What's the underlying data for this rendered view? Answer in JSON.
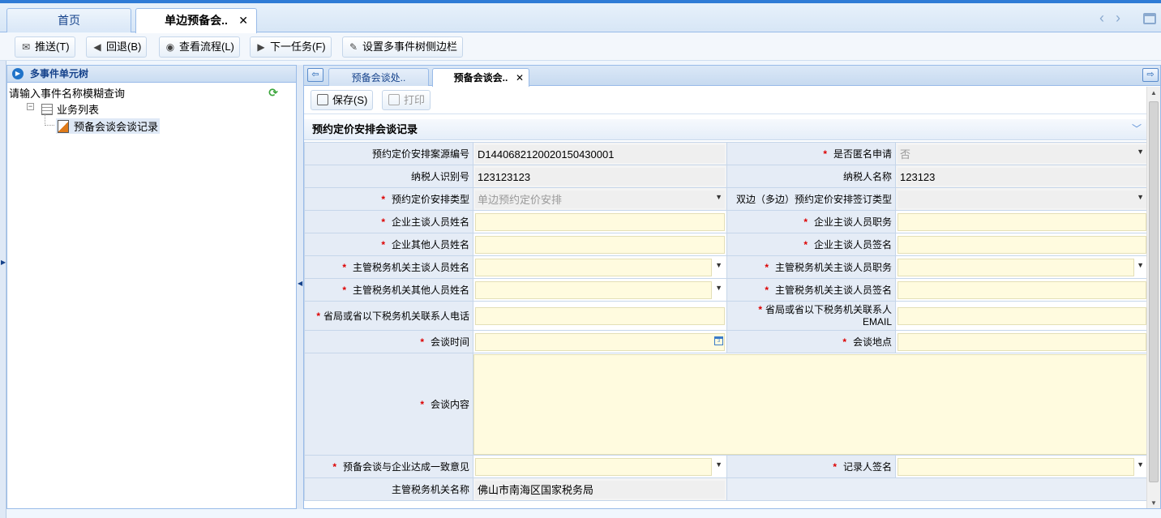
{
  "top_tabs": [
    {
      "label": "首页"
    },
    {
      "label": "单边预备会.."
    }
  ],
  "toolbar": {
    "push": "推送(T)",
    "back": "回退(B)",
    "view_flow": "查看流程(L)",
    "next_task": "下一任务(F)",
    "set_sidebar": "设置多事件树侧边栏"
  },
  "left_panel": {
    "title": "多事件单元树",
    "search_placeholder": "请输入事件名称模糊查询",
    "tree_root": "业务列表",
    "tree_child": "预备会谈会谈记录"
  },
  "right_tabs": [
    {
      "label": "预备会谈处.."
    },
    {
      "label": "预备会谈会.."
    }
  ],
  "form_toolbar": {
    "save": "保存(S)",
    "print": "打印"
  },
  "section_title": "预约定价安排会谈记录",
  "form": {
    "case_no_label": "预约定价安排案源编号",
    "case_no_value": "D1440682120020150430001",
    "anonymous_label": "是否匿名申请",
    "anonymous_value": "否",
    "taxpayer_id_label": "纳税人识别号",
    "taxpayer_id_value": "123123123",
    "taxpayer_name_label": "纳税人名称",
    "taxpayer_name_value": "123123",
    "apa_type_label": "预约定价安排类型",
    "apa_type_value": "单边预约定价安排",
    "bilateral_type_label": "双边（多边）预约定价安排签订类型",
    "bilateral_type_value": "",
    "ent_main_name_label": "企业主谈人员姓名",
    "ent_main_title_label": "企业主谈人员职务",
    "ent_other_name_label": "企业其他人员姓名",
    "ent_sign_label": "企业主谈人员签名",
    "tax_main_name_label": "主管税务机关主谈人员姓名",
    "tax_main_title_label": "主管税务机关主谈人员职务",
    "tax_other_name_label": "主管税务机关其他人员姓名",
    "tax_sign_label": "主管税务机关主谈人员签名",
    "prov_phone_label": "省局或省以下税务机关联系人电话",
    "prov_email_label_1": "省局或省以下税务机关联系人",
    "prov_email_label_2": "EMAIL",
    "meeting_time_label": "会谈时间",
    "meeting_place_label": "会谈地点",
    "content_label": "会谈内容",
    "consensus_label": "预备会谈与企业达成一致意见",
    "recorder_sign_label": "记录人签名",
    "tax_office_label": "主管税务机关名称",
    "tax_office_value": "佛山市南海区国家税务局"
  },
  "colors": {
    "accent": "#2f7bd6",
    "required_bg": "#fffbdf",
    "label_bg": "#e5ecf6",
    "required_star": "#dd0000"
  }
}
